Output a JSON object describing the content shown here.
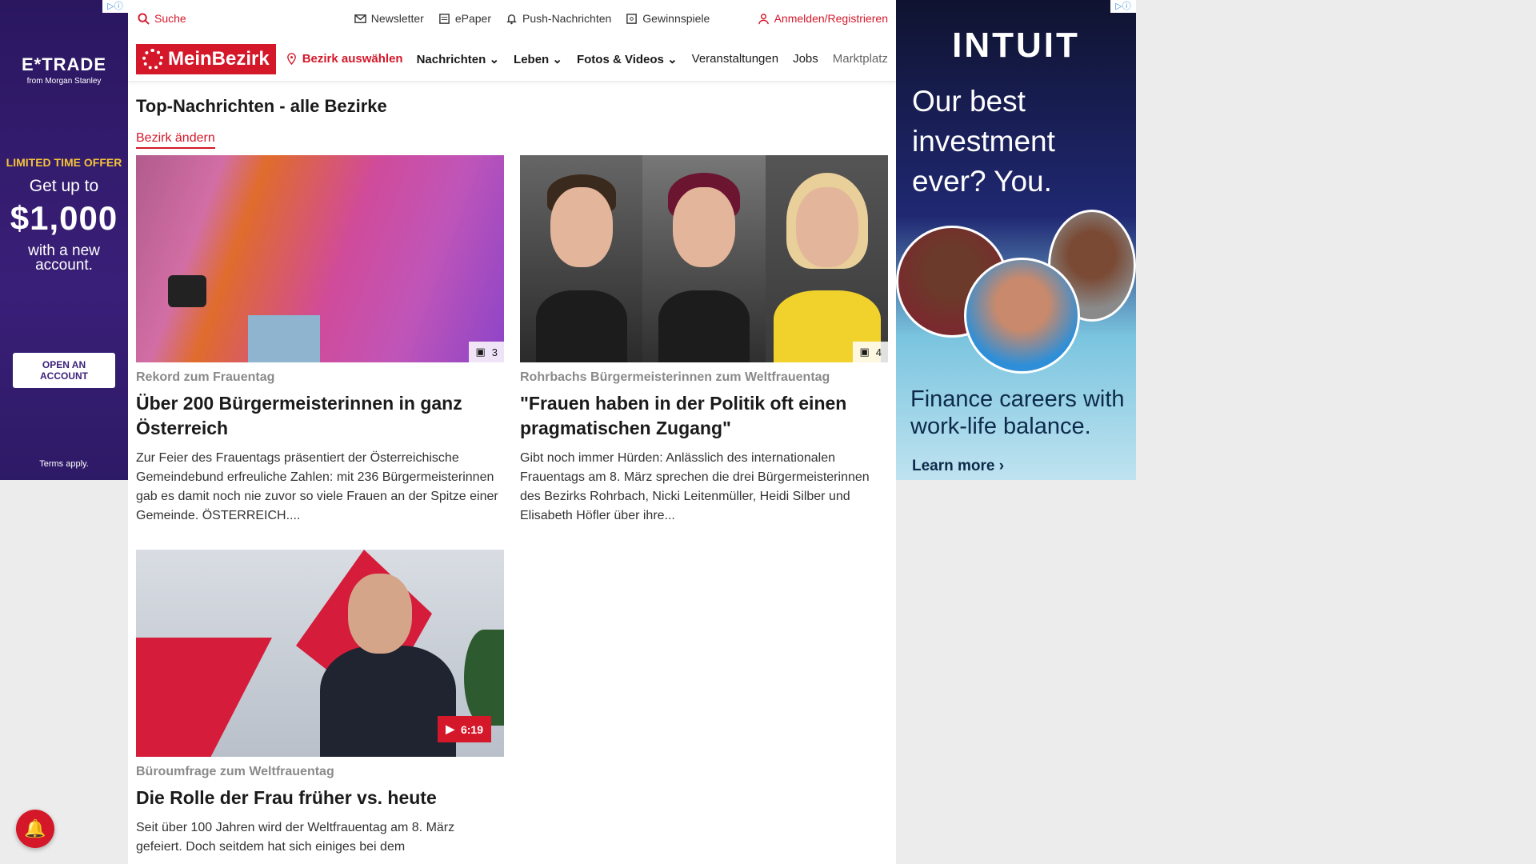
{
  "ad_left": {
    "brand": "E*TRADE",
    "brand_sub": "from Morgan Stanley",
    "offer": "LIMITED TIME OFFER",
    "get": "Get up to",
    "amount": "$1,000",
    "with": "with a new account.",
    "cta": "OPEN AN ACCOUNT",
    "terms": "Terms apply."
  },
  "topbar": {
    "search": "Suche",
    "newsletter": "Newsletter",
    "epaper": "ePaper",
    "push": "Push-Nachrichten",
    "gewinnspiele": "Gewinnspiele",
    "login": "Anmelden/Registrieren"
  },
  "navbar": {
    "logo": "MeinBezirk",
    "bezirk": "Bezirk auswählen",
    "links": [
      "Nachrichten",
      "Leben",
      "Fotos & Videos",
      "Veranstaltungen",
      "Jobs",
      "Marktplatz"
    ]
  },
  "page": {
    "title": "Top-Nachrichten - alle Bezirke",
    "change": "Bezirk ändern"
  },
  "cards": [
    {
      "badge": "3",
      "kicker": "Rekord zum Frauentag",
      "headline": "Über 200 Bürgermeisterinnen in ganz Österreich",
      "teaser": "Zur Feier des Frauentags präsentiert der Österreichische Gemeindebund erfreuliche Zahlen: mit 236 Bürgermeisterinnen gab es damit noch nie zuvor so viele Frauen an der Spitze einer Gemeinde. ÖSTERREICH...."
    },
    {
      "badge": "4",
      "kicker": "Rohrbachs Bürgermeisterinnen zum Weltfrauentag",
      "headline": "\"Frauen haben in der Politik oft einen pragmatischen Zugang\"",
      "teaser": "Gibt noch immer Hürden: Anlässlich des internationalen Frauentags am 8. März sprechen die drei Bürgermeisterinnen des Bezirks Rohrbach, Nicki Leitenmüller, Heidi Silber und Elisabeth Höfler über ihre..."
    },
    {
      "video": "6:19",
      "kicker": "Büroumfrage zum Weltfrauentag",
      "headline": "Die Rolle der Frau früher vs. heute",
      "teaser": "Seit über 100 Jahren wird der Weltfrauentag am 8. März gefeiert. Doch seitdem hat sich einiges bei dem"
    }
  ],
  "ad_right": {
    "brand": "INTUIT",
    "headline": "Our best investment ever? You.",
    "sub": "Finance careers with work-life balance.",
    "learn": "Learn more ›"
  },
  "colors": {
    "brand_red": "#d4182a"
  }
}
